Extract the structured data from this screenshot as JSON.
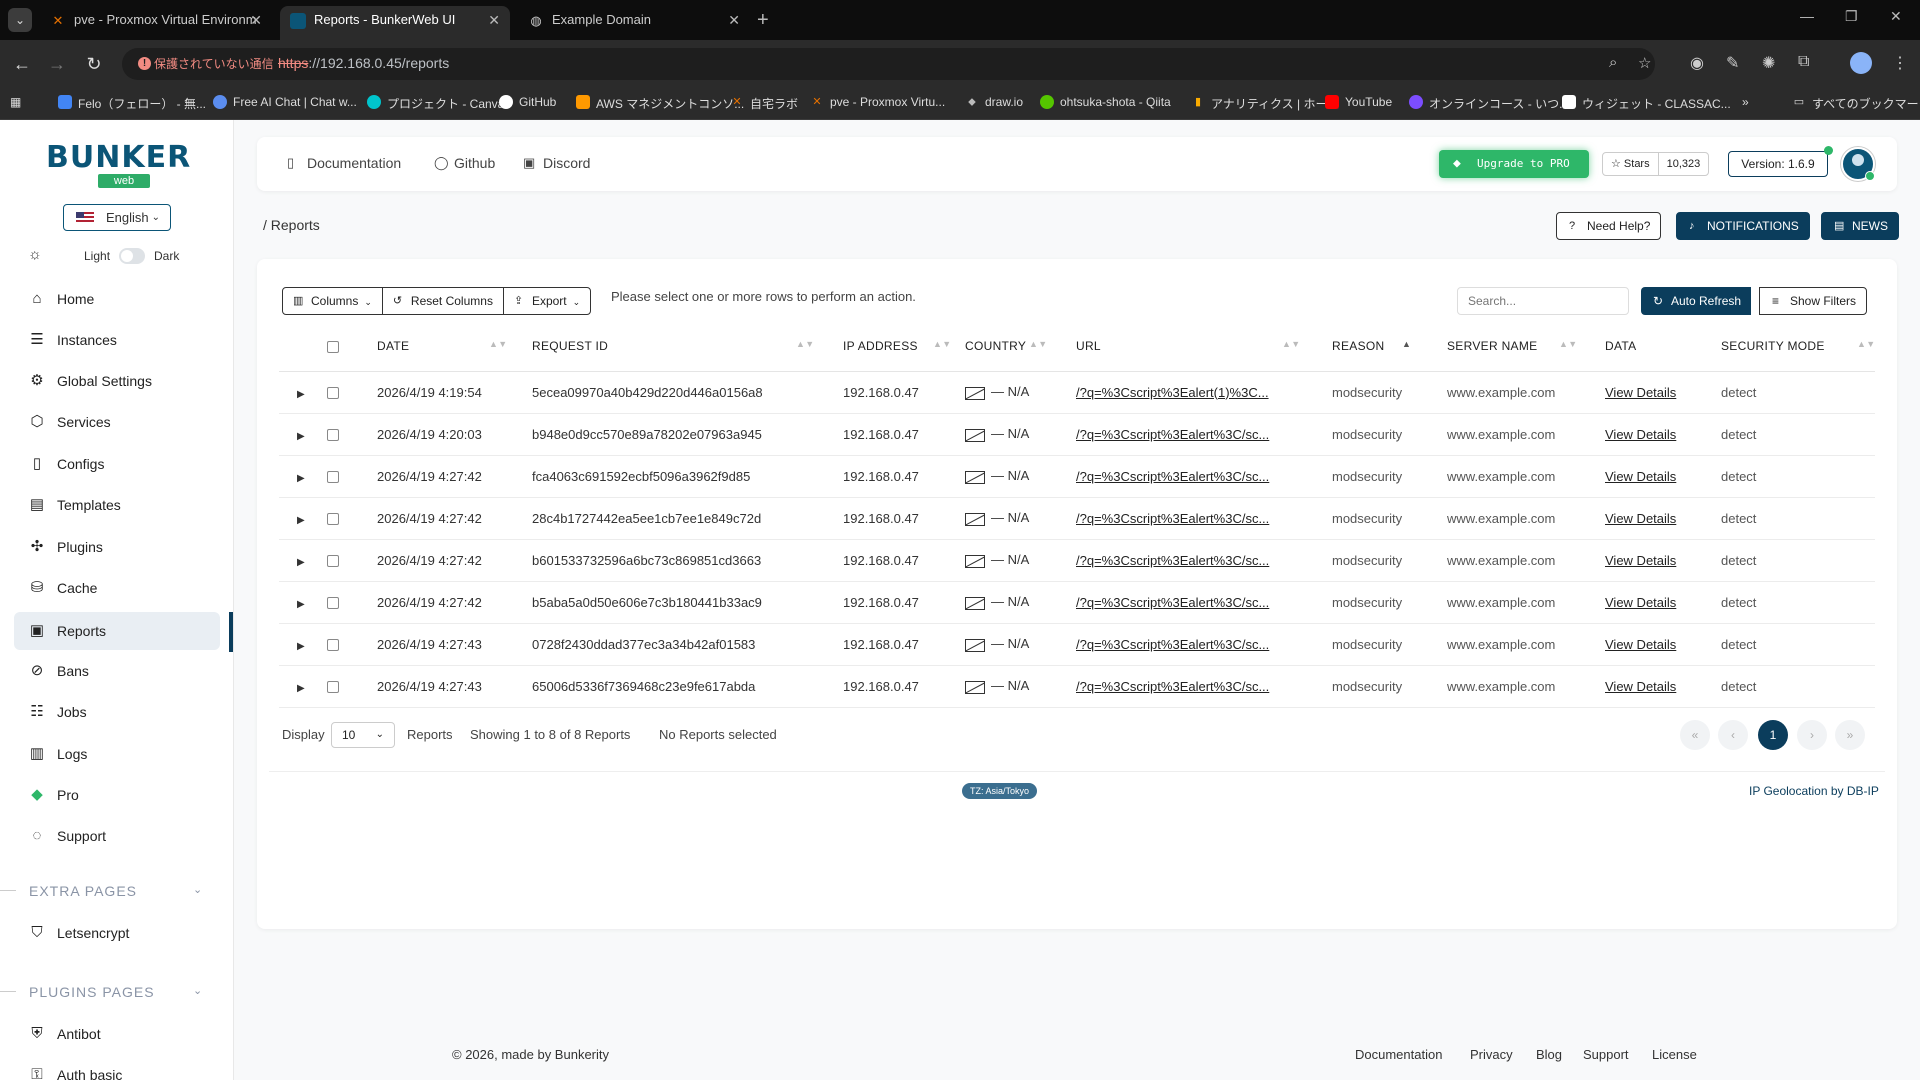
{
  "browser": {
    "tabs": [
      {
        "title": "pve - Proxmox Virtual Environm",
        "icon": "proxmox-icon"
      },
      {
        "title": "Reports - BunkerWeb UI",
        "icon": "bunkerweb-icon"
      },
      {
        "title": "Example Domain",
        "icon": "globe-icon"
      }
    ],
    "security_label": "保護されていない通信",
    "url_scheme": "https",
    "url_rest": "://192.168.0.45/reports",
    "bookmarks": [
      "Felo（フェロー） - 無...",
      "Free AI Chat | Chat w...",
      "プロジェクト - Canva",
      "GitHub",
      "AWS マネジメントコンソ...",
      "自宅ラボ",
      "pve - Proxmox Virtu...",
      "draw.io",
      "ohtsuka-shota - Qiita",
      "アナリティクス | ホーム",
      "YouTube",
      "オンラインコース - いつ...",
      "ウィジェット - CLASSAC..."
    ],
    "all_bookmarks": "すべてのブックマーク",
    "more_bookmarks": "»"
  },
  "sidebar": {
    "logo": "BUNKER",
    "logo_sub": "web",
    "language": "English",
    "theme_light": "Light",
    "theme_dark": "Dark",
    "items": [
      {
        "label": "Home",
        "icon": "home-icon"
      },
      {
        "label": "Instances",
        "icon": "server-icon"
      },
      {
        "label": "Global Settings",
        "icon": "gear-icon"
      },
      {
        "label": "Services",
        "icon": "cube-icon"
      },
      {
        "label": "Configs",
        "icon": "file-icon"
      },
      {
        "label": "Templates",
        "icon": "template-icon"
      },
      {
        "label": "Plugins",
        "icon": "puzzle-icon"
      },
      {
        "label": "Cache",
        "icon": "database-icon"
      },
      {
        "label": "Reports",
        "icon": "clipboard-icon"
      },
      {
        "label": "Bans",
        "icon": "ban-icon"
      },
      {
        "label": "Jobs",
        "icon": "list-icon"
      },
      {
        "label": "Logs",
        "icon": "logs-icon"
      },
      {
        "label": "Pro",
        "icon": "diamond-icon"
      },
      {
        "label": "Support",
        "icon": "support-icon"
      }
    ],
    "extra_pages_title": "EXTRA PAGES",
    "extra_pages": [
      {
        "label": "Letsencrypt",
        "icon": "letsencrypt-icon"
      }
    ],
    "plugins_pages_title": "PLUGINS PAGES",
    "plugins_pages": [
      {
        "label": "Antibot",
        "icon": "shield-icon"
      },
      {
        "label": "Auth basic",
        "icon": "lock-icon"
      }
    ]
  },
  "topbar": {
    "links": [
      "Documentation",
      "Github",
      "Discord"
    ],
    "upgrade": "Upgrade to PRO",
    "stars_label": "Stars",
    "stars_count": "10,323",
    "version": "Version: 1.6.9"
  },
  "header": {
    "breadcrumb": "/  Reports",
    "need_help": "Need Help?",
    "notifications": "NOTIFICATIONS",
    "news": "NEWS"
  },
  "reports": {
    "toolbar": {
      "columns": "Columns",
      "reset_columns": "Reset Columns",
      "export": "Export",
      "hint": "Please select one or more rows to perform an action.",
      "search_placeholder": "Search...",
      "auto_refresh": "Auto Refresh",
      "show_filters": "Show Filters"
    },
    "columns": [
      "DATE",
      "REQUEST ID",
      "IP ADDRESS",
      "COUNTRY",
      "URL",
      "REASON",
      "SERVER NAME",
      "DATA",
      "SECURITY MODE"
    ],
    "rows": [
      {
        "date": "2026/4/19 4:19:54",
        "id": "5ecea09970a40b429d220d446a0156a8",
        "ip": "192.168.0.47",
        "country": "N/A",
        "url": "/?q=%3Cscript%3Ealert(1)%3C...",
        "reason": "modsecurity",
        "server": "www.example.com",
        "data": "View Details",
        "mode": "detect"
      },
      {
        "date": "2026/4/19 4:20:03",
        "id": "b948e0d9cc570e89a78202e07963a945",
        "ip": "192.168.0.47",
        "country": "N/A",
        "url": "/?q=%3Cscript%3Ealert%3C/sc...",
        "reason": "modsecurity",
        "server": "www.example.com",
        "data": "View Details",
        "mode": "detect"
      },
      {
        "date": "2026/4/19 4:27:42",
        "id": "fca4063c691592ecbf5096a3962f9d85",
        "ip": "192.168.0.47",
        "country": "N/A",
        "url": "/?q=%3Cscript%3Ealert%3C/sc...",
        "reason": "modsecurity",
        "server": "www.example.com",
        "data": "View Details",
        "mode": "detect"
      },
      {
        "date": "2026/4/19 4:27:42",
        "id": "28c4b1727442ea5ee1cb7ee1e849c72d",
        "ip": "192.168.0.47",
        "country": "N/A",
        "url": "/?q=%3Cscript%3Ealert%3C/sc...",
        "reason": "modsecurity",
        "server": "www.example.com",
        "data": "View Details",
        "mode": "detect"
      },
      {
        "date": "2026/4/19 4:27:42",
        "id": "b601533732596a6bc73c869851cd3663",
        "ip": "192.168.0.47",
        "country": "N/A",
        "url": "/?q=%3Cscript%3Ealert%3C/sc...",
        "reason": "modsecurity",
        "server": "www.example.com",
        "data": "View Details",
        "mode": "detect"
      },
      {
        "date": "2026/4/19 4:27:42",
        "id": "b5aba5a0d50e606e7c3b180441b33ac9",
        "ip": "192.168.0.47",
        "country": "N/A",
        "url": "/?q=%3Cscript%3Ealert%3C/sc...",
        "reason": "modsecurity",
        "server": "www.example.com",
        "data": "View Details",
        "mode": "detect"
      },
      {
        "date": "2026/4/19 4:27:43",
        "id": "0728f2430ddad377ec3a34b42af01583",
        "ip": "192.168.0.47",
        "country": "N/A",
        "url": "/?q=%3Cscript%3Ealert%3C/sc...",
        "reason": "modsecurity",
        "server": "www.example.com",
        "data": "View Details",
        "mode": "detect"
      },
      {
        "date": "2026/4/19 4:27:43",
        "id": "65006d5336f7369468c23e9fe617abda",
        "ip": "192.168.0.47",
        "country": "N/A",
        "url": "/?q=%3Cscript%3Ealert%3C/sc...",
        "reason": "modsecurity",
        "server": "www.example.com",
        "data": "View Details",
        "mode": "detect"
      }
    ],
    "footer": {
      "display_label": "Display",
      "page_size": "10",
      "reports_label": "Reports",
      "showing": "Showing 1 to 8 of 8 Reports",
      "selected": "No Reports selected",
      "current_page": "1",
      "timezone": "TZ: Asia/Tokyo",
      "geolocation": "IP Geolocation by DB-IP"
    }
  },
  "page_footer": {
    "copyright": "© 2026, made by Bunkerity",
    "links": [
      "Documentation",
      "Privacy",
      "Blog",
      "Support",
      "License"
    ]
  },
  "colors": {
    "primary": "#0b3d5c",
    "brand": "#0b5577",
    "success": "#2eb769"
  }
}
